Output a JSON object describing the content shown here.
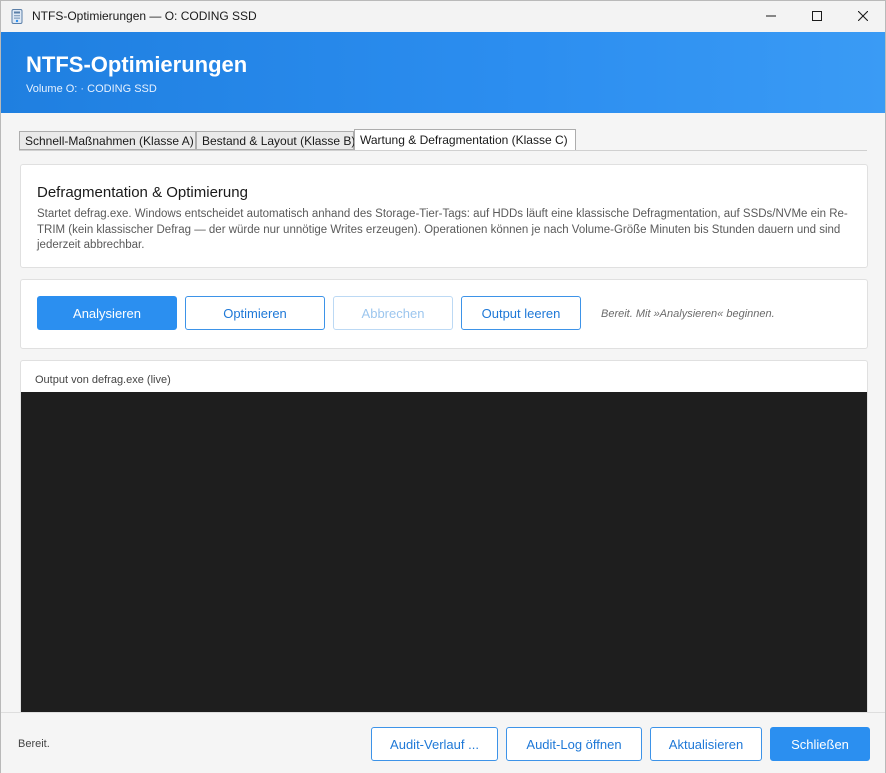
{
  "window": {
    "title": "NTFS-Optimierungen — O: CODING SSD",
    "controls": {
      "minimize_icon": "minimize-icon",
      "maximize_icon": "maximize-icon",
      "close_icon": "close-icon"
    }
  },
  "header": {
    "title": "NTFS-Optimierungen",
    "subtitle": "Volume O: · CODING SSD"
  },
  "tabs": [
    {
      "label": "Schnell-Maßnahmen (Klasse A)",
      "active": false
    },
    {
      "label": "Bestand & Layout (Klasse B)",
      "active": false
    },
    {
      "label": "Wartung & Defragmentation (Klasse C)",
      "active": true
    }
  ],
  "info": {
    "title": "Defragmentation & Optimierung",
    "description": "Startet defrag.exe. Windows entscheidet automatisch anhand des Storage-Tier-Tags: auf HDDs läuft eine klassische Defragmentation, auf SSDs/NVMe ein Re-TRIM (kein klassischer Defrag — der würde nur unnötige Writes erzeugen). Operationen können je nach Volume-Größe Minuten bis Stunden dauern und sind jederzeit abbrechbar."
  },
  "actions": {
    "analyze_label": "Analysieren",
    "optimize_label": "Optimieren",
    "cancel_label": "Abbrechen",
    "clear_label": "Output leeren",
    "status_hint": "Bereit. Mit »Analysieren« beginnen."
  },
  "output": {
    "label": "Output von defrag.exe (live)",
    "content": ""
  },
  "footer": {
    "status": "Bereit.",
    "audit_history_label": "Audit-Verlauf ...",
    "audit_log_label": "Audit-Log öffnen",
    "refresh_label": "Aktualisieren",
    "close_label": "Schließen"
  },
  "colors": {
    "accent": "#2b8ff0",
    "header_gradient_start": "#1f7fe0",
    "console_background": "#1e1e1e"
  }
}
